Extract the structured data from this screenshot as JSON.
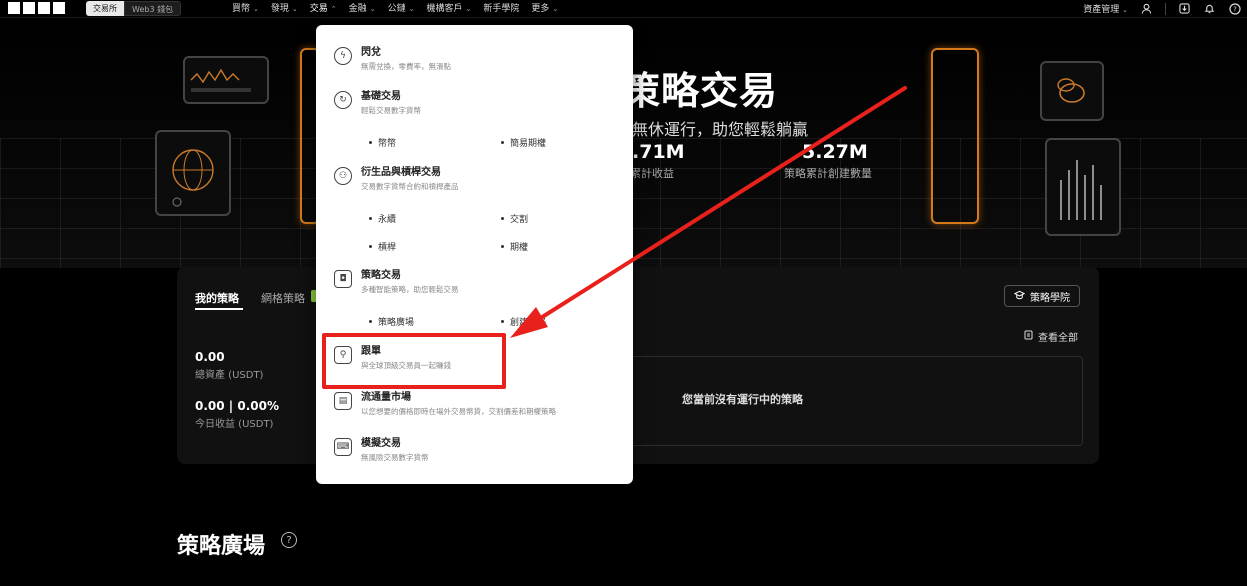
{
  "nav": {
    "seg_exchange": "交易所",
    "seg_web3": "Web3 錢包",
    "items": [
      {
        "label": "買幣",
        "chev": true
      },
      {
        "label": "發現",
        "chev": true
      },
      {
        "label": "交易",
        "chev": true
      },
      {
        "label": "金融",
        "chev": true
      },
      {
        "label": "公鏈",
        "chev": true
      },
      {
        "label": "機構客戶",
        "chev": true
      },
      {
        "label": "新手學院",
        "chev": false
      },
      {
        "label": "更多",
        "chev": true
      }
    ],
    "asset_mgmt": "資產管理",
    "chev_glyph": "⌄"
  },
  "hero": {
    "title": "策略交易",
    "subtitle": "無休運行，助您輕鬆躺贏",
    "stat1_value": ".71M",
    "stat1_label": "策略累計收益",
    "stat2_value": "5.27M",
    "stat2_label": "策略累計創建數量"
  },
  "panel": {
    "tab_my": "我的策略",
    "tab_grid": "網格策略",
    "academy": "策略學院",
    "view_all": "查看全部",
    "total_assets_value": "0.00",
    "total_assets_label": "總資產 (USDT)",
    "today_value": "0.00 | 0.00%",
    "today_label": "今日收益 (USDT)",
    "empty_msg": "您當前沒有運行中的策略"
  },
  "section": {
    "title": "策略廣場"
  },
  "dropdown": {
    "flash": {
      "title": "閃兌",
      "desc": "無需兌換，零費率，無滑點"
    },
    "basic": {
      "title": "基礎交易",
      "desc": "輕鬆交易數字貨幣"
    },
    "basic_subs": [
      "幣幣",
      "簡易期權"
    ],
    "deriv": {
      "title": "衍生品與槓桿交易",
      "desc": "交易數字貨幣合約和槓桿產品"
    },
    "deriv_subs": [
      "永續",
      "交割",
      "槓桿",
      "期權"
    ],
    "strategy": {
      "title": "策略交易",
      "desc": "多種智能策略，助您輕鬆交易"
    },
    "strategy_subs": [
      "策略廣場",
      "創建策略"
    ],
    "copy": {
      "title": "跟單",
      "desc": "與全球頂級交易員一起賺錢"
    },
    "liquidity": {
      "title": "流通量市場",
      "desc": "以您想要的價格即時在場外交易幣貨，交割價差和期權策略"
    },
    "demo": {
      "title": "模擬交易",
      "desc": "無風險交易數字貨幣"
    }
  },
  "colors": {
    "highlight": "#e8211c",
    "accent_orange": "#d47a1a",
    "badge_green": "#8ecb3b"
  }
}
